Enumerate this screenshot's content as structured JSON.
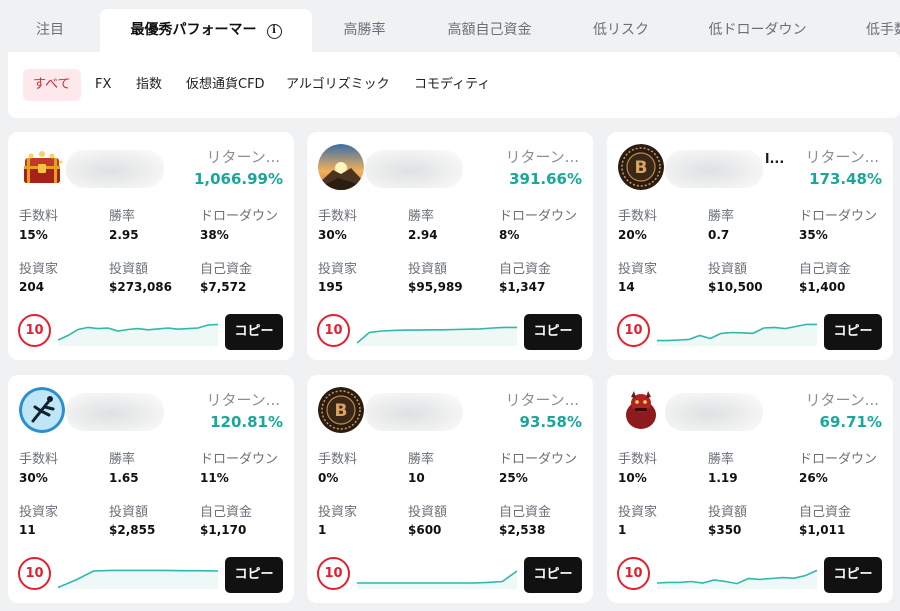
{
  "tabs": [
    {
      "label": "注目",
      "active": false
    },
    {
      "label": "最優秀パフォーマー",
      "active": true
    },
    {
      "label": "高勝率",
      "active": false
    },
    {
      "label": "高額自己資金",
      "active": false
    },
    {
      "label": "低リスク",
      "active": false
    },
    {
      "label": "低ドローダウン",
      "active": false
    },
    {
      "label": "低手数",
      "active": false
    }
  ],
  "filters": [
    {
      "label": "すべて",
      "active": true
    },
    {
      "label": "FX",
      "active": false
    },
    {
      "label": "指数",
      "active": false
    },
    {
      "label": "仮想通貨CFD",
      "active": false
    },
    {
      "label": "アルゴリズミック",
      "active": false
    },
    {
      "label": "コモディティ",
      "active": false
    }
  ],
  "labels": {
    "return": "リターン...",
    "fee": "手数料",
    "win_rate": "勝率",
    "drawdown": "ドローダウン",
    "investors": "投資家",
    "invested": "投資額",
    "equity": "自己資金",
    "copy": "コピー"
  },
  "colors": {
    "accent": "#e5202e",
    "positive": "#18a89a",
    "spark": "#2fb8ab"
  },
  "cards": [
    {
      "avatar": "treasure-chest",
      "name_suffix": "",
      "return": "1,066.99%",
      "fee": "15%",
      "win_rate": "2.95",
      "drawdown": "38%",
      "investors": "204",
      "invested": "$273,086",
      "equity": "$7,572",
      "level": "10",
      "spark": [
        0.2,
        0.35,
        0.55,
        0.62,
        0.58,
        0.6,
        0.5,
        0.55,
        0.58,
        0.54,
        0.57,
        0.6,
        0.56,
        0.58,
        0.6,
        0.7,
        0.72
      ]
    },
    {
      "avatar": "mountain-sunrise",
      "name_suffix": "",
      "return": "391.66%",
      "fee": "30%",
      "win_rate": "2.94",
      "drawdown": "8%",
      "investors": "195",
      "invested": "$95,989",
      "equity": "$1,347",
      "level": "10",
      "spark": [
        0.1,
        0.45,
        0.5,
        0.52,
        0.53,
        0.53,
        0.54,
        0.54,
        0.55,
        0.56,
        0.57,
        0.6,
        0.62,
        0.62
      ]
    },
    {
      "avatar": "bitcoin-coin",
      "name_suffix": "l...",
      "return": "173.48%",
      "fee": "20%",
      "win_rate": "0.7",
      "drawdown": "35%",
      "investors": "14",
      "invested": "$10,500",
      "equity": "$1,400",
      "level": "10",
      "spark": [
        0.18,
        0.18,
        0.2,
        0.22,
        0.35,
        0.25,
        0.42,
        0.45,
        0.44,
        0.42,
        0.6,
        0.62,
        0.58,
        0.65,
        0.72,
        0.72
      ]
    },
    {
      "avatar": "skydiver",
      "name_suffix": "",
      "return": "120.81%",
      "fee": "30%",
      "win_rate": "1.65",
      "drawdown": "11%",
      "investors": "11",
      "invested": "$2,855",
      "equity": "$1,170",
      "level": "10",
      "spark": [
        0.05,
        0.3,
        0.6,
        0.62,
        0.62,
        0.62,
        0.62,
        0.61,
        0.61,
        0.6
      ]
    },
    {
      "avatar": "bitcoin-coin",
      "name_suffix": "",
      "return": "93.58%",
      "fee": "0%",
      "win_rate": "10",
      "drawdown": "25%",
      "investors": "1",
      "invested": "$600",
      "equity": "$2,538",
      "level": "10",
      "spark": [
        0.2,
        0.2,
        0.2,
        0.2,
        0.2,
        0.2,
        0.2,
        0.2,
        0.2,
        0.22,
        0.25,
        0.6
      ]
    },
    {
      "avatar": "red-beast",
      "name_suffix": "",
      "return": "69.71%",
      "fee": "10%",
      "win_rate": "1.19",
      "drawdown": "26%",
      "investors": "1",
      "invested": "$350",
      "equity": "$1,011",
      "level": "10",
      "spark": [
        0.2,
        0.22,
        0.22,
        0.25,
        0.2,
        0.3,
        0.25,
        0.18,
        0.35,
        0.32,
        0.35,
        0.38,
        0.36,
        0.45,
        0.62
      ]
    }
  ]
}
